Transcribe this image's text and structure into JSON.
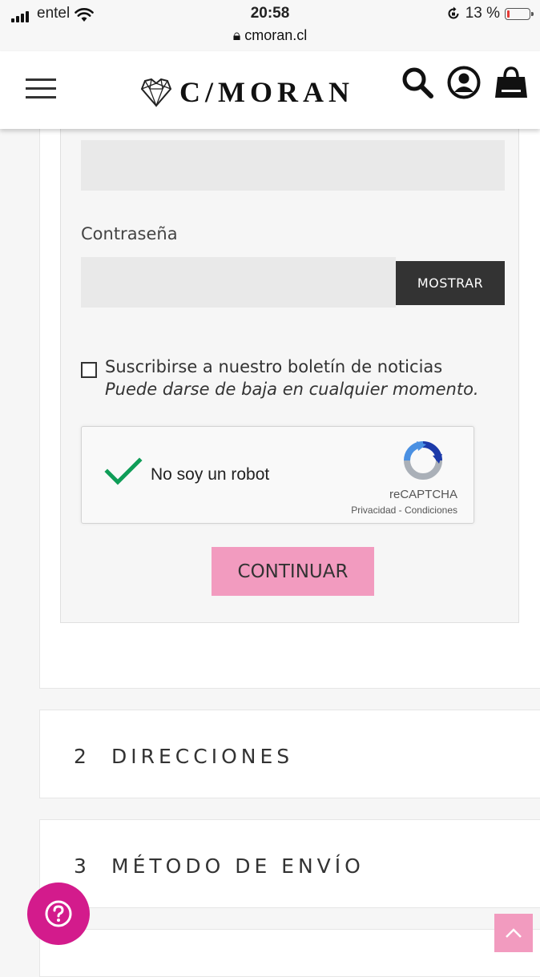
{
  "status_bar": {
    "carrier": "entel",
    "time": "20:58",
    "url": "cmoran.cl",
    "battery": "13 %",
    "battery_level": 0.13
  },
  "header": {
    "logo_text": "C/MORAN",
    "icons": [
      "hamburger-menu-icon",
      "search-icon",
      "account-icon",
      "shopping-bag-icon"
    ]
  },
  "form": {
    "password_label": "Contraseña",
    "show_button": "MOSTRAR",
    "newsletter_label": "Suscribirse a nuestro boletín de noticias",
    "newsletter_sub": "Puede darse de baja en cualquier momento.",
    "newsletter_checked": false,
    "continue_button": "CONTINUAR"
  },
  "recaptcha": {
    "label": "No soy un robot",
    "brand": "reCAPTCHA",
    "links": "Privacidad - Condiciones",
    "checked": true
  },
  "steps": [
    {
      "number": "2",
      "title": "DIRECCIONES"
    },
    {
      "number": "3",
      "title": "MÉTODO DE ENVÍO"
    }
  ],
  "colors": {
    "accent_pink": "#f29bbf",
    "help_magenta": "#d31b8c",
    "recaptcha_check": "#0f9d58"
  }
}
